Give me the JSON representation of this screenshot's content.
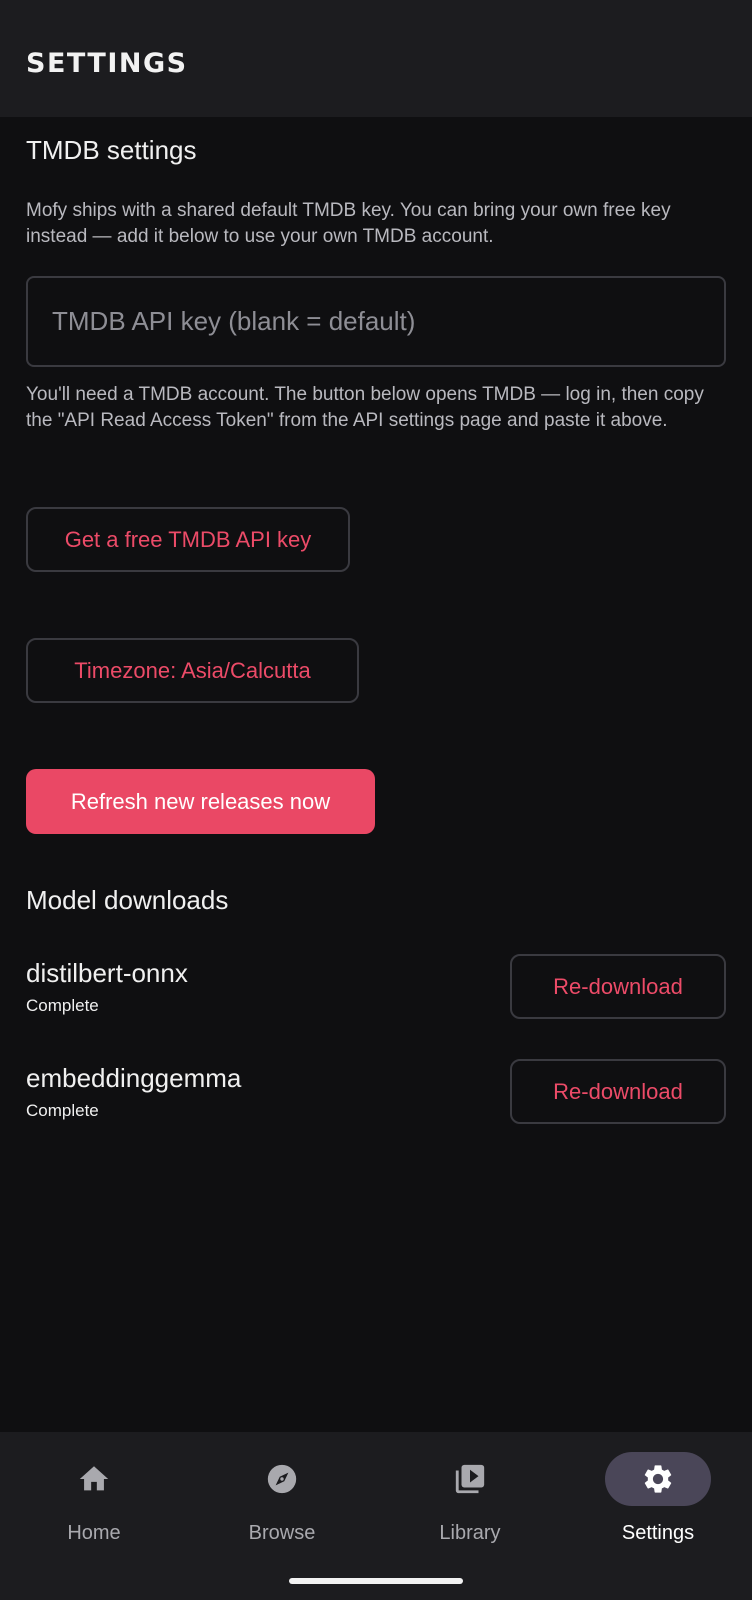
{
  "header": {
    "title": "SETTINGS"
  },
  "tmdb": {
    "title": "TMDB settings",
    "description": "Mofy ships with a shared default TMDB key. You can bring your own free key instead — add it below to use your own TMDB account.",
    "input_value": "",
    "input_placeholder": "TMDB API key (blank = default)",
    "help_text": "You'll need a TMDB account. The button below opens TMDB — log in, then copy the \"API Read Access Token\" from the API settings page and paste it above.",
    "get_key_button": "Get a free TMDB API key"
  },
  "timezone_button": "Timezone: Asia/Calcutta",
  "refresh_button": "Refresh new releases now",
  "models": {
    "title": "Model downloads",
    "items": [
      {
        "name": "distilbert-onnx",
        "status": "Complete",
        "action": "Re-download"
      },
      {
        "name": "embeddinggemma",
        "status": "Complete",
        "action": "Re-download"
      }
    ]
  },
  "nav": {
    "items": [
      {
        "label": "Home",
        "icon": "home-icon",
        "active": false
      },
      {
        "label": "Browse",
        "icon": "compass-icon",
        "active": false
      },
      {
        "label": "Library",
        "icon": "library-icon",
        "active": false
      },
      {
        "label": "Settings",
        "icon": "gear-icon",
        "active": true
      }
    ]
  },
  "colors": {
    "accent": "#ea4865",
    "background": "#0f0f11",
    "surface": "#1c1c1f",
    "active_pill": "#4a4658"
  }
}
